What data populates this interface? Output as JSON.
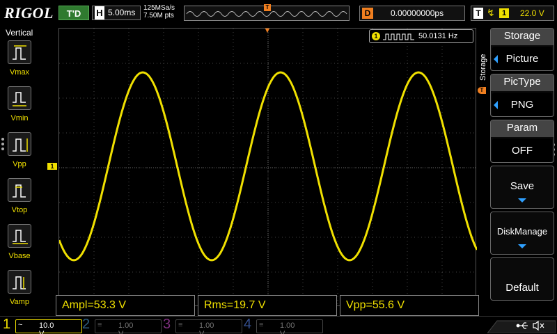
{
  "topbar": {
    "brand": "RIGOL",
    "run_status": "T'D",
    "horizontal_key": "H",
    "timebase": "5.00ms",
    "sample_rate": "125MSa/s",
    "memory_depth": "7.50M pts",
    "delay_key": "D",
    "delay": "0.00000000ps",
    "trigger_key": "T",
    "trigger_channel": "1",
    "trigger_level": "22.0 V"
  },
  "left_menu": {
    "title": "Vertical",
    "items": [
      {
        "label": "Vmax",
        "icon": "vmax-icon"
      },
      {
        "label": "Vmin",
        "icon": "vmin-icon"
      },
      {
        "label": "Vpp",
        "icon": "vpp-icon"
      },
      {
        "label": "Vtop",
        "icon": "vtop-icon"
      },
      {
        "label": "Vbase",
        "icon": "vbase-icon"
      },
      {
        "label": "Vamp",
        "icon": "vamp-icon"
      }
    ]
  },
  "waveform": {
    "channel": "1",
    "frequency": "50.0131 Hz",
    "color": "#f0e000"
  },
  "measurements": [
    {
      "text": "Ampl=53.3 V"
    },
    {
      "text": "Rms=19.7 V"
    },
    {
      "text": "Vpp=55.6 V"
    }
  ],
  "right_menu": {
    "side_label": "Storage",
    "items": [
      {
        "title": "Storage",
        "value": "Picture"
      },
      {
        "title": "PicType",
        "value": "PNG"
      },
      {
        "title": "Param",
        "value": "OFF"
      },
      {
        "title": "Save"
      },
      {
        "title": "DiskManage"
      },
      {
        "title": "Default"
      }
    ]
  },
  "channels": [
    {
      "number": "1",
      "coupling": "~",
      "scale": "10.0 V",
      "color": "#f0e000",
      "active": true
    },
    {
      "number": "2",
      "coupling": "",
      "scale": "1.00 V",
      "color": "#2fa8ff",
      "active": false
    },
    {
      "number": "3",
      "coupling": "",
      "scale": "1.00 V",
      "color": "#d040d0",
      "active": false
    },
    {
      "number": "4",
      "coupling": "",
      "scale": "1.00 V",
      "color": "#3a6cff",
      "active": false
    }
  ]
}
